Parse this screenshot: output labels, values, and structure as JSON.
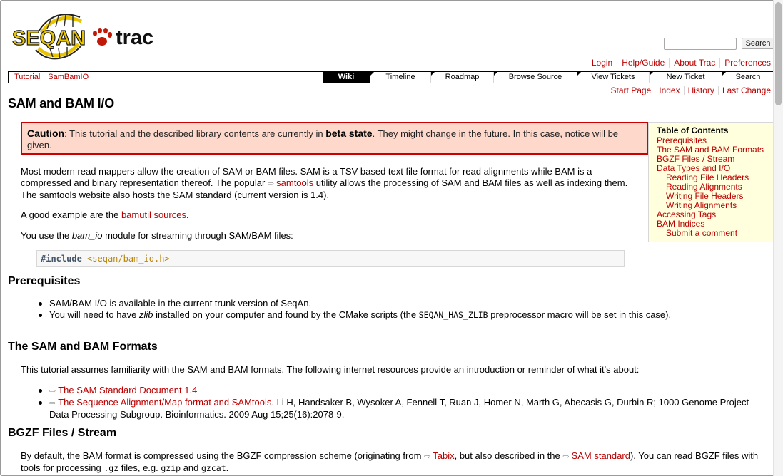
{
  "logo": {
    "text_left": "SEQAN",
    "text_right": "trac"
  },
  "search": {
    "placeholder": "",
    "button": "Search"
  },
  "metanav": [
    "Login",
    "Help/Guide",
    "About Trac",
    "Preferences"
  ],
  "ctxnav": [
    "Tutorial",
    "SamBamIO"
  ],
  "mainnav": [
    "Wiki",
    "Timeline",
    "Roadmap",
    "Browse Source",
    "View Tickets",
    "New Ticket",
    "Search"
  ],
  "wikinav": [
    "Start Page",
    "Index",
    "History",
    "Last Change"
  ],
  "page_title": "SAM and BAM I/O",
  "caution": {
    "label": "Caution",
    "t1": ": This tutorial and the described library contents are currently in ",
    "strong": "beta state",
    "t2": ". They might change in the future. In this case, notice will be given."
  },
  "toc": {
    "title": "Table of Contents",
    "items": [
      {
        "label": "Prerequisites",
        "level": 1
      },
      {
        "label": "The SAM and BAM Formats",
        "level": 1
      },
      {
        "label": "BGZF Files / Stream",
        "level": 1
      },
      {
        "label": "Data Types and I/O",
        "level": 1
      },
      {
        "label": "Reading File Headers",
        "level": 2
      },
      {
        "label": "Reading Alignments",
        "level": 2
      },
      {
        "label": "Writing File Headers",
        "level": 2
      },
      {
        "label": "Writing Alignments",
        "level": 2
      },
      {
        "label": "Accessing Tags",
        "level": 1
      },
      {
        "label": "BAM Indices",
        "level": 1
      },
      {
        "label": "Submit a comment",
        "level": 2
      }
    ]
  },
  "intro": {
    "p1a": "Most modern read mappers allow the creation of SAM or BAM files. SAM is a TSV-based text file format for read alignments while BAM is a compressed and binary representation thereof. The popular ",
    "p1_link": "samtools",
    "p1b": " utility allows the processing of SAM and BAM files as well as indexing them. The samtools website also hosts the SAM standard (current version is 1.4).",
    "p2a": "A good example are the ",
    "p2_link": "bamutil sources",
    "p2b": ".",
    "p3a": "You use the ",
    "p3_em": "bam_io",
    "p3b": " module for streaming through SAM/BAM files:"
  },
  "code": {
    "hash": "#",
    "keyword": "include",
    "header": "<seqan/bam_io.h>"
  },
  "sections": {
    "prereq": {
      "title": "Prerequisites",
      "b1": "SAM/BAM I/O is available in the current trunk version of SeqAn.",
      "b2a": "You will need to have ",
      "b2_em": "zlib",
      "b2b": " installed on your computer and found by the CMake scripts (the ",
      "b2_code": "SEQAN_HAS_ZLIB",
      "b2c": " preprocessor macro will be set in this case)."
    },
    "formats": {
      "title": "The SAM and BAM Formats",
      "intro": "This tutorial assumes familiarity with the SAM and BAM formats. The following internet resources provide an introduction or reminder of what it's about:",
      "l1": "The SAM Standard Document 1.4",
      "l2": "The Sequence Alignment/Map format and SAMtools.",
      "l2_rest": " Li H, Handsaker B, Wysoker A, Fennell T, Ruan J, Homer N, Marth G, Abecasis G, Durbin R; 1000 Genome Project Data Processing Subgroup. Bioinformatics. 2009 Aug 15;25(16):2078-9."
    },
    "bgzf": {
      "title": "BGZF Files / Stream",
      "t1": "By default, the BAM format is compressed using the BGZF compression scheme (originating from ",
      "link1": "Tabix",
      "t2": ", but also described in the ",
      "link2": "SAM standard",
      "t3": "). You can read BGZF files with tools for processing ",
      "c1": ".gz",
      "t4": " files, e.g. ",
      "c2": "gzip",
      "t5": " and ",
      "c3": "gzcat",
      "t6": "."
    }
  }
}
